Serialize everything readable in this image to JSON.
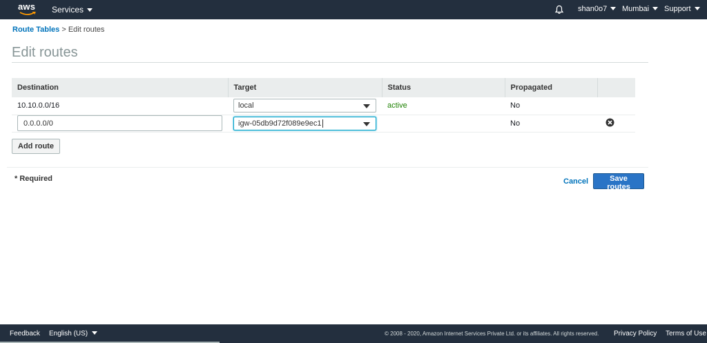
{
  "topnav": {
    "logo_text": "aws",
    "services_label": "Services",
    "account_label": "shan0o7",
    "region_label": "Mumbai",
    "support_label": "Support"
  },
  "breadcrumb": {
    "parent": "Route Tables",
    "separator": ">",
    "current": "Edit routes"
  },
  "page": {
    "title": "Edit routes"
  },
  "table": {
    "headers": [
      "Destination",
      "Target",
      "Status",
      "Propagated"
    ],
    "rows": [
      {
        "destination": "10.10.0.0/16",
        "target": "local",
        "status": "active",
        "propagated": "No"
      },
      {
        "destination": "0.0.0.0/0",
        "target": "igw-05db9d72f089e9ec1",
        "status": "",
        "propagated": "No"
      }
    ]
  },
  "actions": {
    "add_route": "Add route",
    "required_note": "* Required",
    "cancel": "Cancel",
    "save": "Save routes"
  },
  "footer": {
    "feedback": "Feedback",
    "language": "English (US)",
    "copyright": "© 2008 - 2020, Amazon Internet Services Private Ltd. or its affiliates. All rights reserved.",
    "privacy": "Privacy Policy",
    "terms": "Terms of Use"
  },
  "colors": {
    "nav_bg": "#232f3e",
    "link": "#0073bb",
    "status_active": "#1d8102",
    "primary_button": "#2a74c6"
  },
  "icons": [
    "aws-logo",
    "caret-down-icon",
    "bell-icon",
    "select-arrow-icon",
    "remove-circle-icon"
  ]
}
